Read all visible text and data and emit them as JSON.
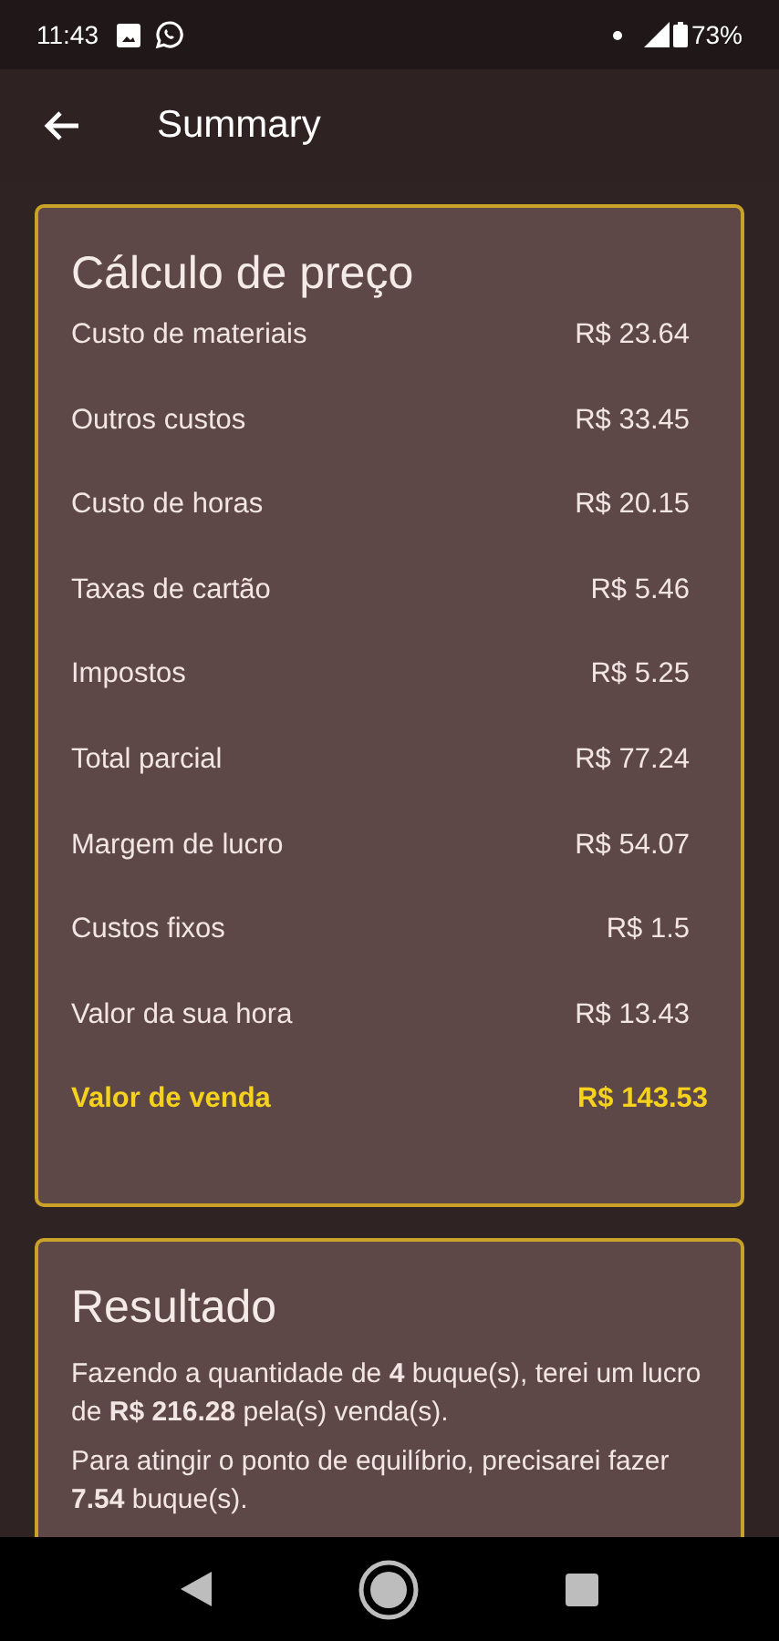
{
  "status_bar": {
    "time": "11:43",
    "battery": "73%"
  },
  "app_bar": {
    "title": "Summary"
  },
  "price_card": {
    "title": "Cálculo de preço",
    "rows": [
      {
        "label": "Custo de materiais",
        "value": "R$ 23.64",
        "kind": "item"
      },
      {
        "label": "Outros custos",
        "value": "R$ 33.45",
        "kind": "item"
      },
      {
        "label": "Custo de horas",
        "value": "R$ 20.15",
        "kind": "item"
      },
      {
        "label": "Taxas de cartão",
        "value": "R$ 5.46",
        "kind": "item"
      },
      {
        "label": "Impostos",
        "value": "R$ 5.25",
        "kind": "item"
      },
      {
        "label": "Total parcial",
        "value": "R$ 77.24",
        "kind": "item"
      },
      {
        "label": "Margem de lucro",
        "value": "R$ 54.07",
        "kind": "item"
      },
      {
        "label": "Custos fixos",
        "value": "R$ 1.5",
        "kind": "item"
      },
      {
        "label": "Valor da sua hora",
        "value": "R$ 13.43",
        "kind": "item"
      },
      {
        "label": "Valor de venda",
        "value": "R$ 143.53",
        "kind": "total"
      }
    ]
  },
  "result_card": {
    "title": "Resultado",
    "paragraphs": [
      "Fazendo a quantidade de **4** buque(s), terei um lucro de **R$ 216.28** pela(s) venda(s).",
      "Para atingir o ponto de equilíbrio, precisarei fazer **7.54** buque(s)."
    ]
  }
}
